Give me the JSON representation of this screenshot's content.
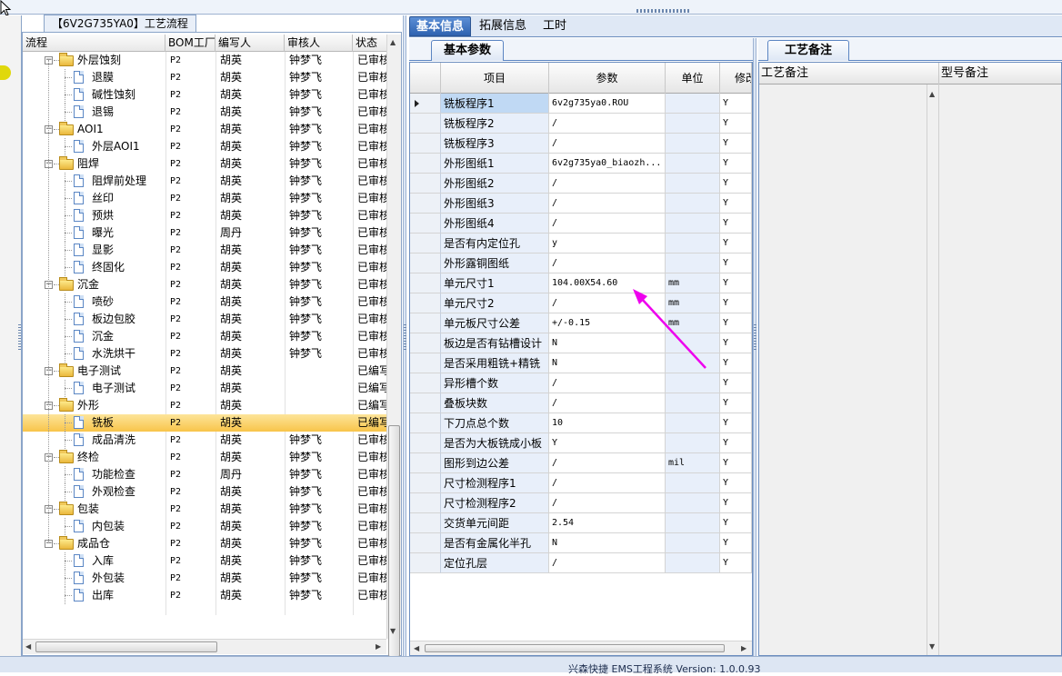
{
  "tree": {
    "title": "【6V2G735YA0】工艺流程",
    "columns": [
      "流程",
      "BOM工厂",
      "编写人",
      "审核人",
      "状态"
    ],
    "rows": [
      {
        "name": "外层蚀刻",
        "level": 0,
        "factory": "P2",
        "author": "胡英",
        "reviewer": "钟梦飞",
        "status": "已审核"
      },
      {
        "name": "退膜",
        "level": 1,
        "factory": "P2",
        "author": "胡英",
        "reviewer": "钟梦飞",
        "status": "已审核"
      },
      {
        "name": "碱性蚀刻",
        "level": 1,
        "factory": "P2",
        "author": "胡英",
        "reviewer": "钟梦飞",
        "status": "已审核"
      },
      {
        "name": "退锡",
        "level": 1,
        "factory": "P2",
        "author": "胡英",
        "reviewer": "钟梦飞",
        "status": "已审核"
      },
      {
        "name": "AOI1",
        "level": 0,
        "factory": "P2",
        "author": "胡英",
        "reviewer": "钟梦飞",
        "status": "已审核"
      },
      {
        "name": "外层AOI1",
        "level": 1,
        "factory": "P2",
        "author": "胡英",
        "reviewer": "钟梦飞",
        "status": "已审核"
      },
      {
        "name": "阻焊",
        "level": 0,
        "factory": "P2",
        "author": "胡英",
        "reviewer": "钟梦飞",
        "status": "已审核"
      },
      {
        "name": "阻焊前处理",
        "level": 1,
        "factory": "P2",
        "author": "胡英",
        "reviewer": "钟梦飞",
        "status": "已审核"
      },
      {
        "name": "丝印",
        "level": 1,
        "factory": "P2",
        "author": "胡英",
        "reviewer": "钟梦飞",
        "status": "已审核"
      },
      {
        "name": "预烘",
        "level": 1,
        "factory": "P2",
        "author": "胡英",
        "reviewer": "钟梦飞",
        "status": "已审核"
      },
      {
        "name": "曝光",
        "level": 1,
        "factory": "P2",
        "author": "周丹",
        "reviewer": "钟梦飞",
        "status": "已审核"
      },
      {
        "name": "显影",
        "level": 1,
        "factory": "P2",
        "author": "胡英",
        "reviewer": "钟梦飞",
        "status": "已审核"
      },
      {
        "name": "终固化",
        "level": 1,
        "factory": "P2",
        "author": "胡英",
        "reviewer": "钟梦飞",
        "status": "已审核"
      },
      {
        "name": "沉金",
        "level": 0,
        "factory": "P2",
        "author": "胡英",
        "reviewer": "钟梦飞",
        "status": "已审核"
      },
      {
        "name": "喷砂",
        "level": 1,
        "factory": "P2",
        "author": "胡英",
        "reviewer": "钟梦飞",
        "status": "已审核"
      },
      {
        "name": "板边包胶",
        "level": 1,
        "factory": "P2",
        "author": "胡英",
        "reviewer": "钟梦飞",
        "status": "已审核"
      },
      {
        "name": "沉金",
        "level": 1,
        "factory": "P2",
        "author": "胡英",
        "reviewer": "钟梦飞",
        "status": "已审核"
      },
      {
        "name": "水洗烘干",
        "level": 1,
        "factory": "P2",
        "author": "胡英",
        "reviewer": "钟梦飞",
        "status": "已审核"
      },
      {
        "name": "电子测试",
        "level": 0,
        "factory": "P2",
        "author": "胡英",
        "reviewer": "",
        "status": "已编写"
      },
      {
        "name": "电子测试",
        "level": 1,
        "factory": "P2",
        "author": "胡英",
        "reviewer": "",
        "status": "已编写"
      },
      {
        "name": "外形",
        "level": 0,
        "factory": "P2",
        "author": "胡英",
        "reviewer": "",
        "status": "已编写"
      },
      {
        "name": "铣板",
        "level": 1,
        "factory": "P2",
        "author": "胡英",
        "reviewer": "",
        "status": "已编写",
        "selected": true
      },
      {
        "name": "成品清洗",
        "level": 1,
        "factory": "P2",
        "author": "胡英",
        "reviewer": "钟梦飞",
        "status": "已审核"
      },
      {
        "name": "终检",
        "level": 0,
        "factory": "P2",
        "author": "胡英",
        "reviewer": "钟梦飞",
        "status": "已审核"
      },
      {
        "name": "功能检查",
        "level": 1,
        "factory": "P2",
        "author": "周丹",
        "reviewer": "钟梦飞",
        "status": "已审核"
      },
      {
        "name": "外观检查",
        "level": 1,
        "factory": "P2",
        "author": "胡英",
        "reviewer": "钟梦飞",
        "status": "已审核"
      },
      {
        "name": "包装",
        "level": 0,
        "factory": "P2",
        "author": "胡英",
        "reviewer": "钟梦飞",
        "status": "已审核"
      },
      {
        "name": "内包装",
        "level": 1,
        "factory": "P2",
        "author": "胡英",
        "reviewer": "钟梦飞",
        "status": "已审核"
      },
      {
        "name": "成品仓",
        "level": 0,
        "factory": "P2",
        "author": "胡英",
        "reviewer": "钟梦飞",
        "status": "已审核"
      },
      {
        "name": "入库",
        "level": 1,
        "factory": "P2",
        "author": "胡英",
        "reviewer": "钟梦飞",
        "status": "已审核"
      },
      {
        "name": "外包装",
        "level": 1,
        "factory": "P2",
        "author": "胡英",
        "reviewer": "钟梦飞",
        "status": "已审核"
      },
      {
        "name": "出库",
        "level": 1,
        "factory": "P2",
        "author": "胡英",
        "reviewer": "钟梦飞",
        "status": "已审核"
      }
    ]
  },
  "tabs": [
    "基本信息",
    "拓展信息",
    "工时"
  ],
  "active_tab": 0,
  "basic": {
    "subtab": "基本参数",
    "columns": [
      "项目",
      "参数",
      "单位",
      "修改"
    ],
    "rows": [
      {
        "item": "铣板程序1",
        "value": "6v2g735ya0.ROU",
        "unit": "",
        "mod": "Y",
        "selected": true
      },
      {
        "item": "铣板程序2",
        "value": "/",
        "unit": "",
        "mod": "Y"
      },
      {
        "item": "铣板程序3",
        "value": "/",
        "unit": "",
        "mod": "Y"
      },
      {
        "item": "外形图纸1",
        "value": "6v2g735ya0_biaozh...",
        "unit": "",
        "mod": "Y"
      },
      {
        "item": "外形图纸2",
        "value": "/",
        "unit": "",
        "mod": "Y"
      },
      {
        "item": "外形图纸3",
        "value": "/",
        "unit": "",
        "mod": "Y"
      },
      {
        "item": "外形图纸4",
        "value": "/",
        "unit": "",
        "mod": "Y"
      },
      {
        "item": "是否有内定位孔",
        "value": "y",
        "unit": "",
        "mod": "Y"
      },
      {
        "item": "外形露铜图纸",
        "value": "/",
        "unit": "",
        "mod": "Y"
      },
      {
        "item": "单元尺寸1",
        "value": "104.00X54.60",
        "unit": "mm",
        "mod": "Y"
      },
      {
        "item": "单元尺寸2",
        "value": "/",
        "unit": "mm",
        "mod": "Y"
      },
      {
        "item": "单元板尺寸公差",
        "value": "+/-0.15",
        "unit": "mm",
        "mod": "Y"
      },
      {
        "item": "板边是否有钻槽设计",
        "value": "N",
        "unit": "",
        "mod": "Y"
      },
      {
        "item": "是否采用粗铣+精铣",
        "value": "N",
        "unit": "",
        "mod": "Y"
      },
      {
        "item": "异形槽个数",
        "value": "/",
        "unit": "",
        "mod": "Y"
      },
      {
        "item": "叠板块数",
        "value": "/",
        "unit": "",
        "mod": "Y"
      },
      {
        "item": "下刀点总个数",
        "value": "10",
        "unit": "",
        "mod": "Y"
      },
      {
        "item": "是否为大板铣成小板",
        "value": "Y",
        "unit": "",
        "mod": "Y"
      },
      {
        "item": "图形到边公差",
        "value": "/",
        "unit": "mil",
        "mod": "Y"
      },
      {
        "item": "尺寸检测程序1",
        "value": "/",
        "unit": "",
        "mod": "Y"
      },
      {
        "item": "尺寸检测程序2",
        "value": "/",
        "unit": "",
        "mod": "Y"
      },
      {
        "item": "交货单元间距",
        "value": "2.54",
        "unit": "",
        "mod": "Y"
      },
      {
        "item": "是否有金属化半孔",
        "value": "N",
        "unit": "",
        "mod": "Y"
      },
      {
        "item": "定位孔层",
        "value": "/",
        "unit": "",
        "mod": "Y"
      }
    ]
  },
  "remarks": {
    "subtab": "工艺备注",
    "columns": [
      "工艺备注",
      "型号备注"
    ]
  },
  "status": {
    "text": "兴森快捷 EMS工程系统 Version: 1.0.0.93"
  },
  "colors": {
    "accent": "#2e62b0",
    "selection": "#f8c44a",
    "annotation_arrow": "#ee00ee"
  }
}
